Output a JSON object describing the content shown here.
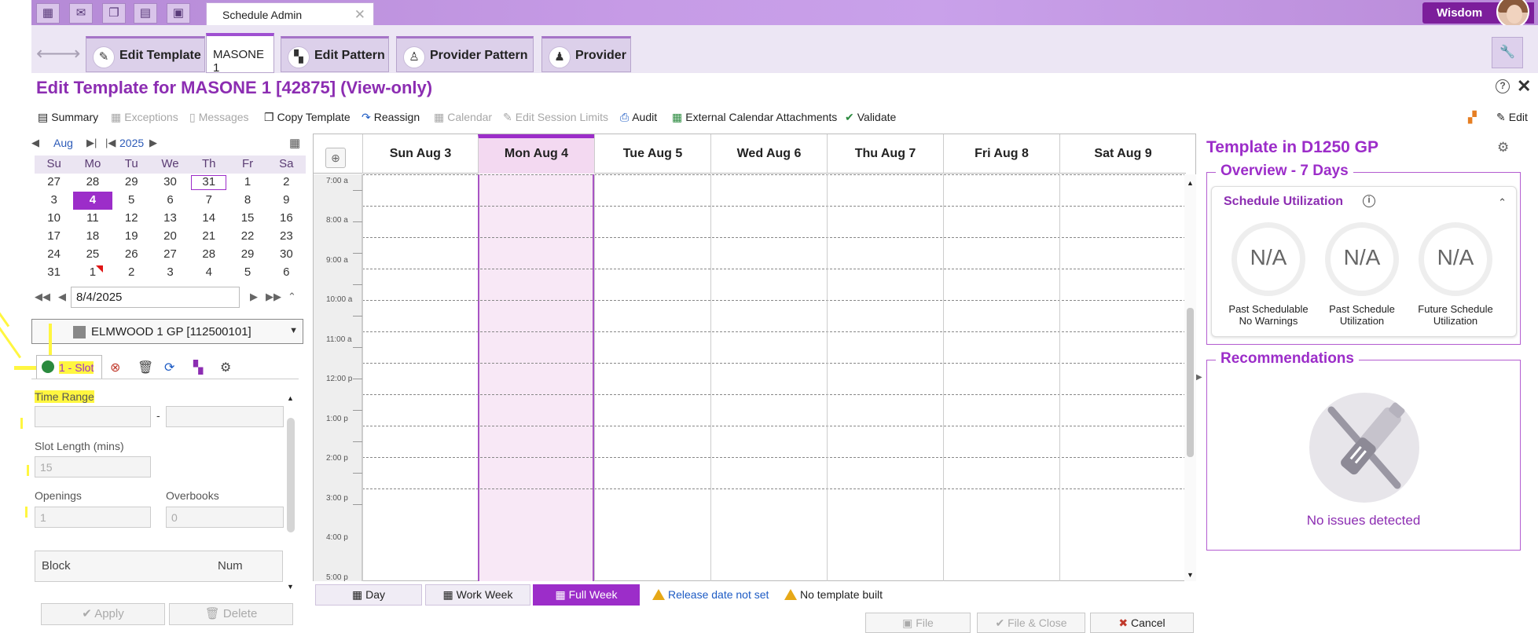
{
  "topbar": {
    "icons": [
      "grid-icon",
      "inbox-icon",
      "windows-icon",
      "calendar-icon",
      "panel-icon"
    ],
    "active_tab_label": "Schedule Admin",
    "active_tab_close": "✕",
    "user_name": "Wisdom"
  },
  "activity_tabs": [
    {
      "label": "Edit Template",
      "icon": "pencil-icon"
    },
    {
      "label": "MASONE 1"
    },
    {
      "label": "Edit Pattern",
      "icon": "checker-icon"
    },
    {
      "label": "Provider Pattern",
      "icon": "person-icon"
    },
    {
      "label": "Provider",
      "icon": "people-icon"
    }
  ],
  "page": {
    "title": "Edit Template for MASONE 1 [42875] (View-only)",
    "help": "?",
    "close": "✕"
  },
  "toolbar": {
    "summary": "Summary",
    "exceptions": "Exceptions",
    "messages": "Messages",
    "copy_template": "Copy Template",
    "reassign": "Reassign",
    "calendar": "Calendar",
    "edit_session_limits": "Edit Session Limits",
    "audit": "Audit",
    "external_calendar": "External Calendar Attachments",
    "validate": "Validate",
    "edit": "Edit"
  },
  "mini_calendar": {
    "month": "Aug",
    "year": "2025",
    "weekdays": [
      "Su",
      "Mo",
      "Tu",
      "We",
      "Th",
      "Fr",
      "Sa"
    ],
    "weeks": [
      [
        "27",
        "28",
        "29",
        "30",
        "31",
        "1",
        "2"
      ],
      [
        "3",
        "4",
        "5",
        "6",
        "7",
        "8",
        "9"
      ],
      [
        "10",
        "11",
        "12",
        "13",
        "14",
        "15",
        "16"
      ],
      [
        "17",
        "18",
        "19",
        "20",
        "21",
        "22",
        "23"
      ],
      [
        "24",
        "25",
        "26",
        "27",
        "28",
        "29",
        "30"
      ],
      [
        "31",
        "1",
        "2",
        "3",
        "4",
        "5",
        "6"
      ]
    ],
    "selected_date": "4",
    "outlined_date": "31"
  },
  "date_field": {
    "value": "8/4/2025"
  },
  "location": {
    "label": "ELMWOOD 1 GP [112500101]"
  },
  "slot_panel": {
    "tab_label": "1 - Slot",
    "time_range_label": "Time Range",
    "time_range_sep": "-",
    "slot_length_label": "Slot Length (mins)",
    "slot_length_value": "15",
    "openings_label": "Openings",
    "openings_value": "1",
    "overbooks_label": "Overbooks",
    "overbooks_value": "0",
    "block_header": "Block",
    "num_header": "Num",
    "apply": "Apply",
    "delete": "Delete"
  },
  "week_grid": {
    "days": [
      "Sun Aug 3",
      "Mon Aug 4",
      "Tue Aug 5",
      "Wed Aug 6",
      "Thu Aug 7",
      "Fri Aug 8",
      "Sat Aug 9"
    ],
    "selected_day": "Mon Aug 4",
    "times": [
      "7:00 a",
      "8:00 a",
      "9:00 a",
      "10:00 a",
      "11:00 a",
      "12:00 p",
      "1:00 p",
      "2:00 p",
      "3:00 p",
      "4:00 p",
      "5:00 p"
    ]
  },
  "view_buttons": {
    "day": "Day",
    "work_week": "Work Week",
    "full_week": "Full Week",
    "active": "Full Week"
  },
  "status": {
    "release_link": "Release date not set",
    "no_template": "No template built"
  },
  "footer_buttons": {
    "file": "File",
    "file_close": "File & Close",
    "cancel": "Cancel"
  },
  "right_panel": {
    "title": "Template in D1250 GP",
    "overview_legend": "Overview - 7 Days",
    "utilization_title": "Schedule Utilization",
    "gauges": [
      {
        "value": "N/A",
        "caption_1": "Past Schedulable",
        "caption_2": "No Warnings"
      },
      {
        "value": "N/A",
        "caption_1": "Past Schedule",
        "caption_2": "Utilization"
      },
      {
        "value": "N/A",
        "caption_1": "Future Schedule",
        "caption_2": "Utilization"
      }
    ],
    "recommendations_legend": "Recommendations",
    "no_issues": "No issues detected"
  },
  "colors": {
    "accent": "#9c2dc9",
    "title": "#8c2db2",
    "link": "#1d5bc4",
    "highlight": "#fff640"
  }
}
